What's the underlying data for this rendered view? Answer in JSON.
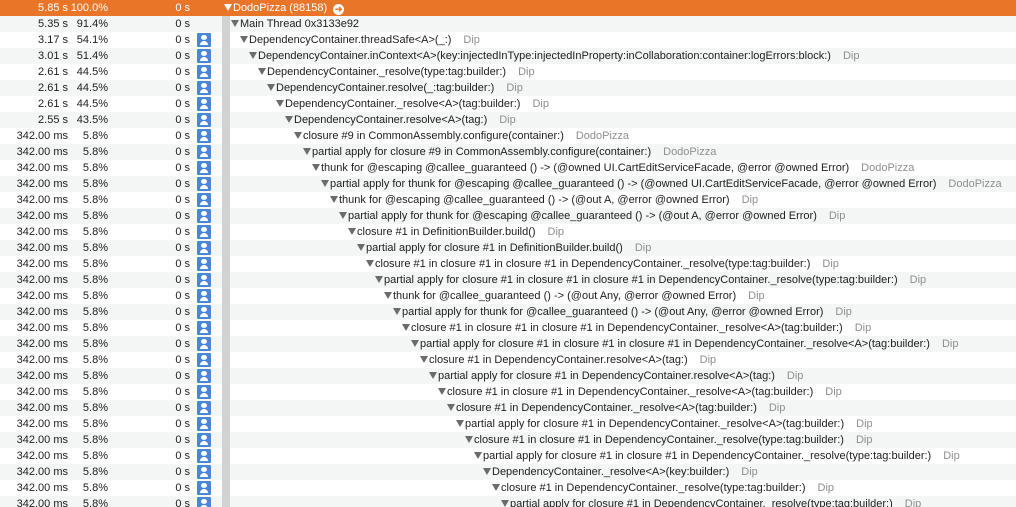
{
  "root": {
    "weight": "5.85 s",
    "percent": "100.0%",
    "self": "0 s",
    "symbol": "DodoPizza (88158)",
    "goto_icon": "arrow-right-circle"
  },
  "rows": [
    {
      "weight": "5.35 s",
      "percent": "91.4%",
      "self": "0 s",
      "user": false,
      "symbol": "Main Thread  0x3133e92",
      "library": ""
    },
    {
      "weight": "3.17 s",
      "percent": "54.1%",
      "self": "0 s",
      "user": true,
      "symbol": "DependencyContainer.threadSafe<A>(_:)",
      "library": "Dip"
    },
    {
      "weight": "3.01 s",
      "percent": "51.4%",
      "self": "0 s",
      "user": true,
      "symbol": "DependencyContainer.inContext<A>(key:injectedInType:injectedInProperty:inCollaboration:container:logErrors:block:)",
      "library": "Dip"
    },
    {
      "weight": "2.61 s",
      "percent": "44.5%",
      "self": "0 s",
      "user": true,
      "symbol": "DependencyContainer._resolve(type:tag:builder:)",
      "library": "Dip"
    },
    {
      "weight": "2.61 s",
      "percent": "44.5%",
      "self": "0 s",
      "user": true,
      "symbol": "DependencyContainer.resolve(_:tag:builder:)",
      "library": "Dip"
    },
    {
      "weight": "2.61 s",
      "percent": "44.5%",
      "self": "0 s",
      "user": true,
      "symbol": "DependencyContainer._resolve<A>(tag:builder:)",
      "library": "Dip"
    },
    {
      "weight": "2.55 s",
      "percent": "43.5%",
      "self": "0 s",
      "user": true,
      "symbol": "DependencyContainer.resolve<A>(tag:)",
      "library": "Dip"
    },
    {
      "weight": "342.00 ms",
      "percent": "5.8%",
      "self": "0 s",
      "user": true,
      "symbol": "closure #9 in CommonAssembly.configure(container:)",
      "library": "DodoPizza"
    },
    {
      "weight": "342.00 ms",
      "percent": "5.8%",
      "self": "0 s",
      "user": true,
      "symbol": "partial apply for closure #9 in CommonAssembly.configure(container:)",
      "library": "DodoPizza"
    },
    {
      "weight": "342.00 ms",
      "percent": "5.8%",
      "self": "0 s",
      "user": true,
      "symbol": "thunk for @escaping @callee_guaranteed () -> (@owned UI.CartEditServiceFacade, @error @owned Error)",
      "library": "DodoPizza"
    },
    {
      "weight": "342.00 ms",
      "percent": "5.8%",
      "self": "0 s",
      "user": true,
      "symbol": "partial apply for thunk for @escaping @callee_guaranteed () -> (@owned UI.CartEditServiceFacade, @error @owned Error)",
      "library": "DodoPizza"
    },
    {
      "weight": "342.00 ms",
      "percent": "5.8%",
      "self": "0 s",
      "user": true,
      "symbol": "thunk for @escaping @callee_guaranteed () -> (@out A, @error @owned Error)",
      "library": "Dip"
    },
    {
      "weight": "342.00 ms",
      "percent": "5.8%",
      "self": "0 s",
      "user": true,
      "symbol": "partial apply for thunk for @escaping @callee_guaranteed () -> (@out A, @error @owned Error)",
      "library": "Dip"
    },
    {
      "weight": "342.00 ms",
      "percent": "5.8%",
      "self": "0 s",
      "user": true,
      "symbol": "closure #1 in DefinitionBuilder.build()",
      "library": "Dip"
    },
    {
      "weight": "342.00 ms",
      "percent": "5.8%",
      "self": "0 s",
      "user": true,
      "symbol": "partial apply for closure #1 in DefinitionBuilder.build()",
      "library": "Dip"
    },
    {
      "weight": "342.00 ms",
      "percent": "5.8%",
      "self": "0 s",
      "user": true,
      "symbol": "closure #1 in closure #1 in closure #1 in DependencyContainer._resolve(type:tag:builder:)",
      "library": "Dip"
    },
    {
      "weight": "342.00 ms",
      "percent": "5.8%",
      "self": "0 s",
      "user": true,
      "symbol": "partial apply for closure #1 in closure #1 in closure #1 in DependencyContainer._resolve(type:tag:builder:)",
      "library": "Dip"
    },
    {
      "weight": "342.00 ms",
      "percent": "5.8%",
      "self": "0 s",
      "user": true,
      "symbol": "thunk for @callee_guaranteed () -> (@out Any, @error @owned Error)",
      "library": "Dip"
    },
    {
      "weight": "342.00 ms",
      "percent": "5.8%",
      "self": "0 s",
      "user": true,
      "symbol": "partial apply for thunk for @callee_guaranteed () -> (@out Any, @error @owned Error)",
      "library": "Dip"
    },
    {
      "weight": "342.00 ms",
      "percent": "5.8%",
      "self": "0 s",
      "user": true,
      "symbol": "closure #1 in closure #1 in closure #1 in DependencyContainer._resolve<A>(tag:builder:)",
      "library": "Dip"
    },
    {
      "weight": "342.00 ms",
      "percent": "5.8%",
      "self": "0 s",
      "user": true,
      "symbol": "partial apply for closure #1 in closure #1 in closure #1 in DependencyContainer._resolve<A>(tag:builder:)",
      "library": "Dip"
    },
    {
      "weight": "342.00 ms",
      "percent": "5.8%",
      "self": "0 s",
      "user": true,
      "symbol": "closure #1 in DependencyContainer.resolve<A>(tag:)",
      "library": "Dip"
    },
    {
      "weight": "342.00 ms",
      "percent": "5.8%",
      "self": "0 s",
      "user": true,
      "symbol": "partial apply for closure #1 in DependencyContainer.resolve<A>(tag:)",
      "library": "Dip"
    },
    {
      "weight": "342.00 ms",
      "percent": "5.8%",
      "self": "0 s",
      "user": true,
      "symbol": "closure #1 in closure #1 in DependencyContainer._resolve<A>(tag:builder:)",
      "library": "Dip"
    },
    {
      "weight": "342.00 ms",
      "percent": "5.8%",
      "self": "0 s",
      "user": true,
      "symbol": "closure #1 in DependencyContainer._resolve<A>(tag:builder:)",
      "library": "Dip"
    },
    {
      "weight": "342.00 ms",
      "percent": "5.8%",
      "self": "0 s",
      "user": true,
      "symbol": "partial apply for closure #1 in DependencyContainer._resolve<A>(tag:builder:)",
      "library": "Dip"
    },
    {
      "weight": "342.00 ms",
      "percent": "5.8%",
      "self": "0 s",
      "user": true,
      "symbol": "closure #1 in closure #1 in DependencyContainer._resolve(type:tag:builder:)",
      "library": "Dip"
    },
    {
      "weight": "342.00 ms",
      "percent": "5.8%",
      "self": "0 s",
      "user": true,
      "symbol": "partial apply for closure #1 in closure #1 in DependencyContainer._resolve(type:tag:builder:)",
      "library": "Dip"
    },
    {
      "weight": "342.00 ms",
      "percent": "5.8%",
      "self": "0 s",
      "user": true,
      "symbol": "DependencyContainer._resolve<A>(key:builder:)",
      "library": "Dip"
    },
    {
      "weight": "342.00 ms",
      "percent": "5.8%",
      "self": "0 s",
      "user": true,
      "symbol": "closure #1 in DependencyContainer._resolve(type:tag:builder:)",
      "library": "Dip"
    },
    {
      "weight": "342.00 ms",
      "percent": "5.8%",
      "self": "0 s",
      "user": true,
      "symbol": "partial apply for closure #1 in DependencyContainer._resolve(type:tag:builder:)",
      "library": "Dip"
    }
  ],
  "colors": {
    "selected_row": "#e87528",
    "user_badge": "#4a86d6",
    "library_text": "#8e8e8e",
    "bar": "#d2d2d2"
  }
}
